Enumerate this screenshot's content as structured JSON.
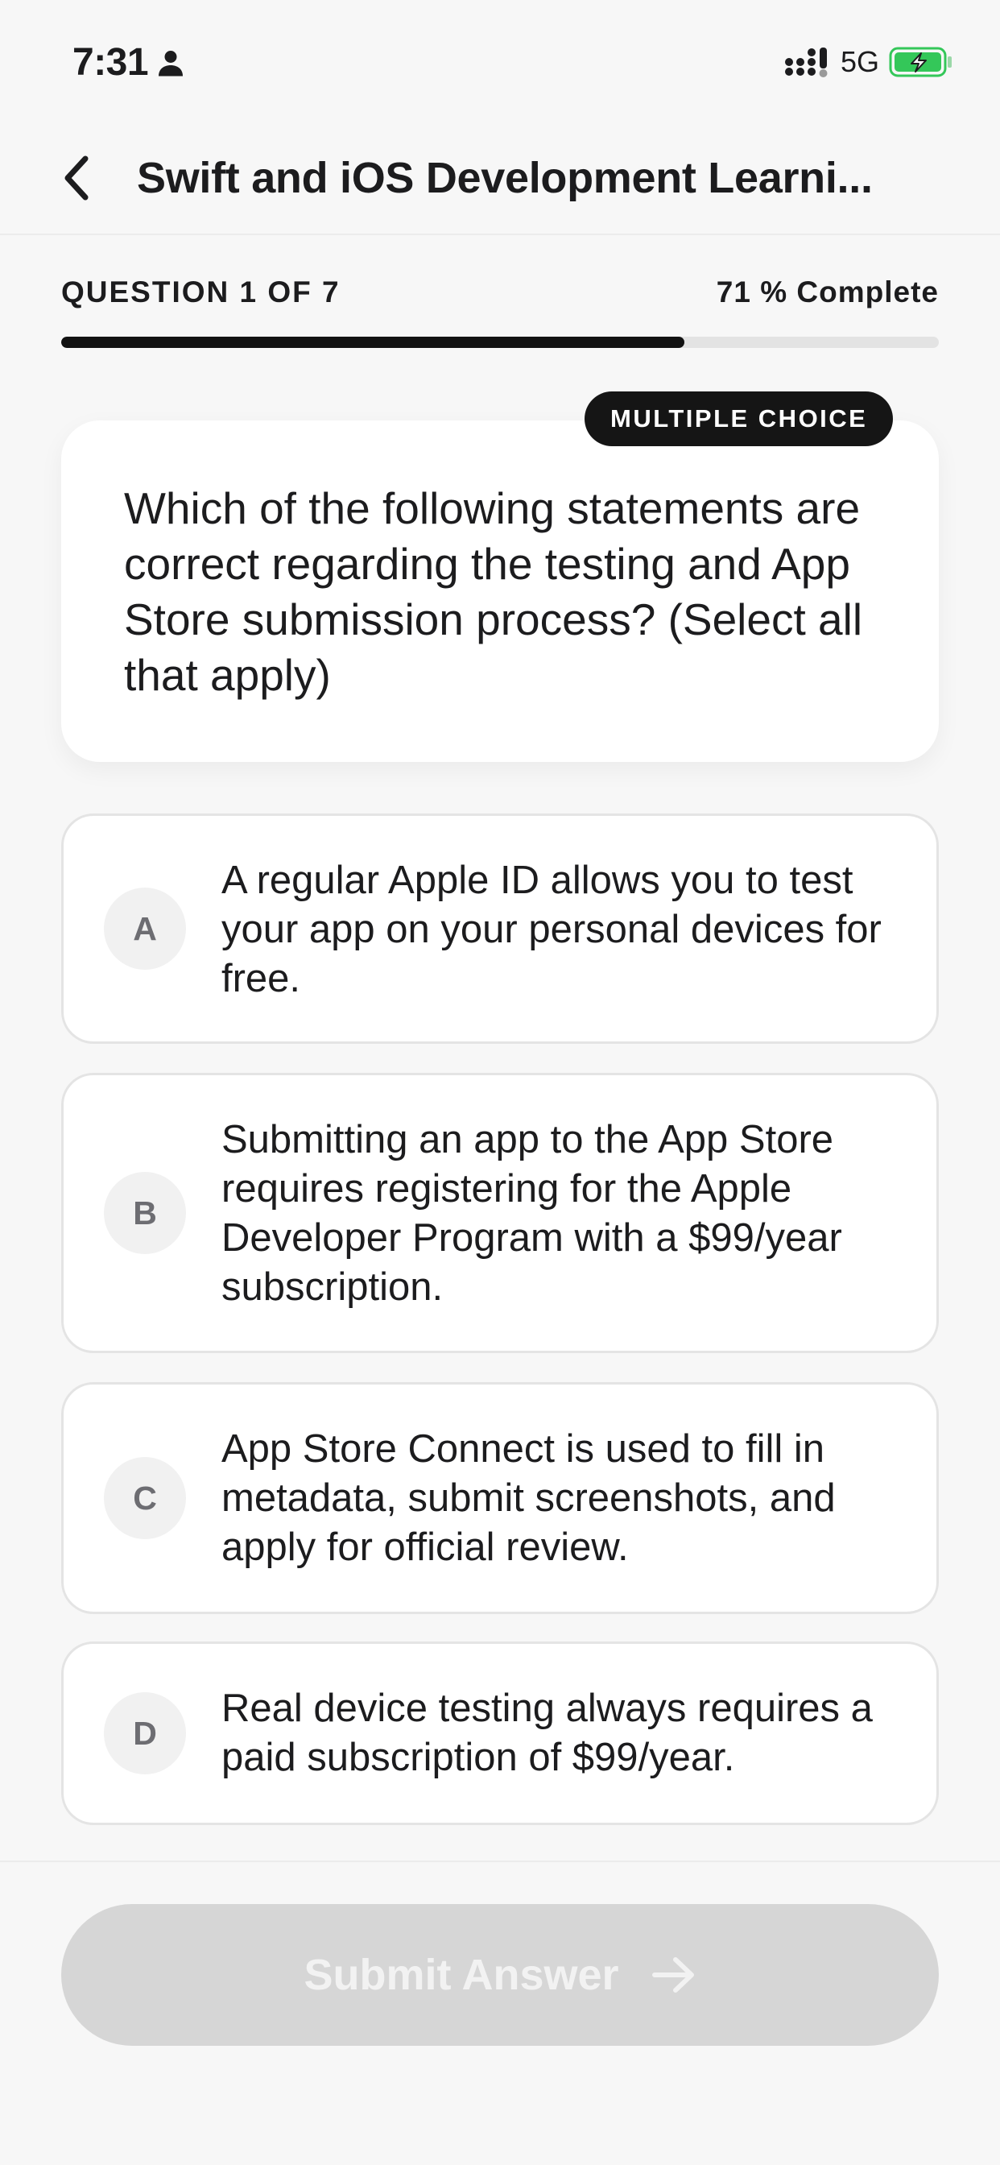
{
  "status_bar": {
    "time": "7:31",
    "network": "5G",
    "icons": [
      "person-icon",
      "signal-icon",
      "battery-charging-icon"
    ]
  },
  "nav": {
    "title": "Swift and iOS Development Learni...",
    "back_icon": "chevron-left-icon"
  },
  "progress": {
    "counter": "QUESTION 1 OF 7",
    "complete_label": "71 % Complete",
    "percent": 71
  },
  "question": {
    "type": "MULTIPLE CHOICE",
    "text": "Which of the following statements are correct regarding the testing and App Store submission process? (Select all that apply)"
  },
  "options": [
    {
      "letter": "A",
      "text": "A regular Apple ID allows you to test your app on your personal devices for free."
    },
    {
      "letter": "B",
      "text": "Submitting an app to the App Store requires registering for the Apple Developer Program with a $99/year subscription."
    },
    {
      "letter": "C",
      "text": "App Store Connect is used to fill in metadata, submit screenshots, and apply for official review."
    },
    {
      "letter": "D",
      "text": "Real device testing always requires a paid subscription of $99/year."
    }
  ],
  "submit": {
    "label": "Submit Answer",
    "icon": "arrow-right-icon",
    "enabled": false
  },
  "colors": {
    "accent": "#121212",
    "background": "#f7f7f7",
    "disabled_button": "#d6d6d6",
    "battery": "#34c759"
  }
}
